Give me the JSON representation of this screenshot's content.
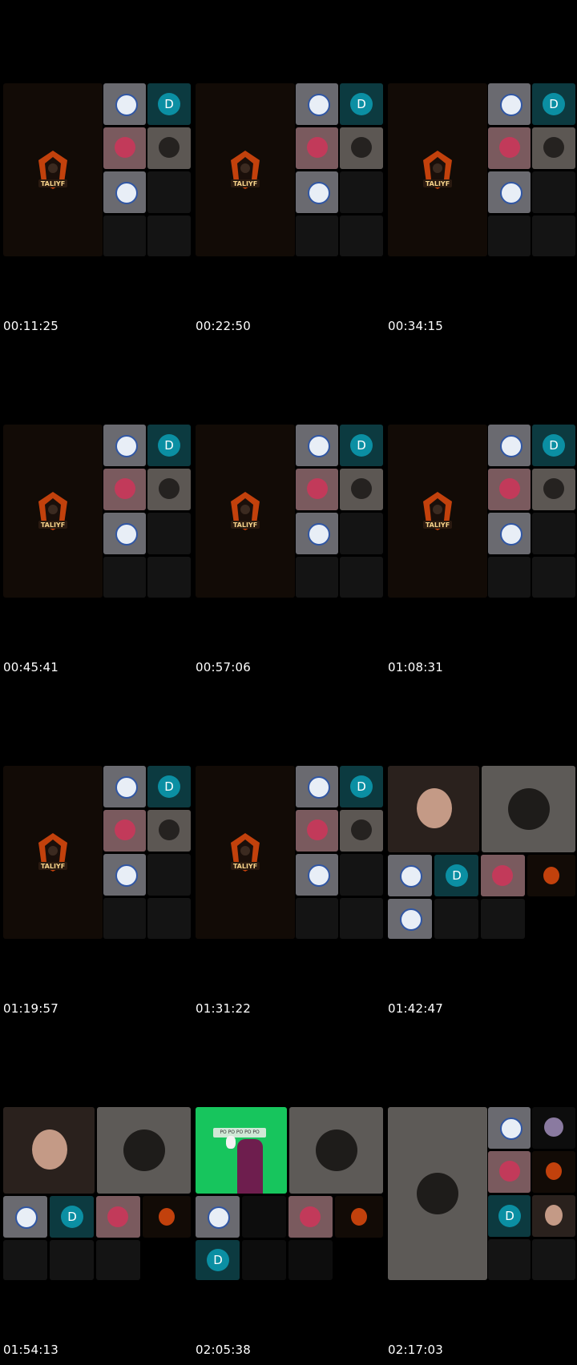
{
  "screenshot": {
    "timestamps": [
      "00:11:25",
      "00:22:50",
      "00:34:15",
      "00:45:41",
      "00:57:06",
      "01:08:31",
      "01:19:57",
      "01:31:22",
      "01:42:47",
      "01:54:13",
      "02:05:38",
      "02:17:03"
    ],
    "avatar_letter": "D",
    "logo_text": "TALIYF",
    "sticker_text": "PO PO PO PO PO"
  },
  "colors": {
    "background": "#000000",
    "teal_avatar": "#0b8fa3",
    "green_screen": "#17c55d"
  }
}
